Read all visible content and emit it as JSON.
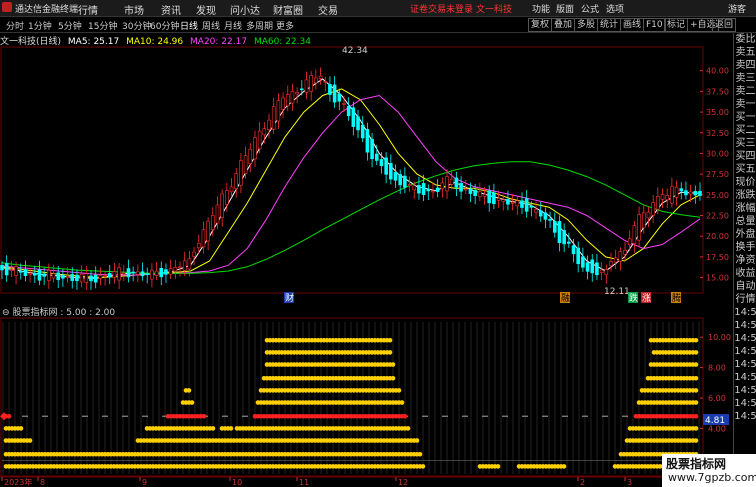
{
  "top_bar": {
    "app_title": "通达信金融终端",
    "menus": [
      "行情",
      "市场",
      "资讯",
      "发现",
      "问小达",
      "财富圈",
      "交易"
    ],
    "notice": "证卷交易未登录",
    "stock_tag": "文一科技",
    "right_menus": [
      "功能",
      "版面",
      "公式",
      "选项"
    ],
    "guest": "游客"
  },
  "toolbar": {
    "timeframes": [
      "分时",
      "1分钟",
      "5分钟",
      "15分钟",
      "30分钟",
      "60分钟",
      "日线",
      "周线",
      "月线",
      "多周期",
      "更多"
    ],
    "active": "日线",
    "right_buttons": [
      "复权",
      "叠加",
      "多股",
      "统计",
      "画线",
      "F10",
      "标记",
      "+自选",
      "返回"
    ]
  },
  "ma_line": {
    "stock": "文一科技(日线)",
    "ma5": "MA5: 25.17",
    "ma10": "MA10: 24.96",
    "ma20": "MA20: 22.17",
    "ma60": "MA60: 22.34"
  },
  "colors": {
    "ma5": "#ffffff",
    "ma10": "#ffff00",
    "ma20": "#ff40ff",
    "ma60": "#00dd00",
    "up": "#ff3030",
    "down": "#00ffff",
    "dot": "#ffd000",
    "red_dot": "#ff2020"
  },
  "price_chart": {
    "y_ticks": [
      "40.00",
      "37.50",
      "35.00",
      "32.50",
      "30.00",
      "27.50",
      "25.00",
      "22.50",
      "20.00",
      "17.50",
      "15.00"
    ],
    "high_label": "42.34",
    "low_label": "12.11",
    "markers": [
      "财",
      "融",
      "跌",
      "涨",
      "腾"
    ]
  },
  "indicator": {
    "title": "股票指标网 : 5.00 : 2.00",
    "y_ticks": [
      "10.00",
      "8.00",
      "6.00",
      "4.00",
      "2.00"
    ],
    "current": "4.81"
  },
  "x_axis": {
    "labels": [
      "2023年",
      "8",
      "9",
      "10",
      "11",
      "12",
      "2",
      "3"
    ]
  },
  "right_panel": [
    "委比",
    "卖五",
    "卖四",
    "卖三",
    "卖二",
    "卖一",
    "买一",
    "买二",
    "买三",
    "买四",
    "买五",
    "现价",
    "涨跌",
    "涨幅",
    "总量",
    "外盘",
    "换手",
    "净资",
    "收益",
    "自动",
    "行情",
    "14:5",
    "14:5",
    "14:5",
    "14:5",
    "14:5",
    "14:5",
    "14:5",
    "14:5",
    "14:5"
  ],
  "watermark": {
    "line1": "股票指标网",
    "line2": "www.7gpzb.com"
  },
  "chart_data": [
    {
      "type": "line",
      "title": "文一科技(日线)",
      "ylim": [
        13.5,
        42.5
      ],
      "series": [
        {
          "name": "MA5",
          "values": [
            16.2,
            15.8,
            15.4,
            15.2,
            15.0,
            14.9,
            15.3,
            15.6,
            15.4,
            15.7,
            16.5,
            20.0,
            24.0,
            28.0,
            32.0,
            35.5,
            37.5,
            39.0,
            37.0,
            34.0,
            30.0,
            27.5,
            26.0,
            25.5,
            26.5,
            25.5,
            24.8,
            24.2,
            23.8,
            22.5,
            20.0,
            17.0,
            15.8,
            17.5,
            21.0,
            24.0,
            25.3,
            25.2
          ]
        },
        {
          "name": "MA10",
          "values": [
            16.3,
            16.0,
            15.7,
            15.4,
            15.2,
            15.0,
            15.1,
            15.3,
            15.5,
            15.6,
            15.8,
            17.0,
            20.5,
            24.0,
            28.0,
            32.0,
            35.0,
            37.0,
            37.8,
            36.5,
            33.5,
            30.0,
            27.5,
            26.2,
            25.8,
            25.8,
            25.3,
            24.5,
            24.0,
            23.5,
            22.0,
            19.5,
            17.5,
            17.0,
            18.5,
            21.5,
            23.8,
            25.0
          ]
        },
        {
          "name": "MA20",
          "values": [
            16.4,
            16.2,
            16.0,
            15.8,
            15.6,
            15.4,
            15.3,
            15.3,
            15.4,
            15.5,
            15.6,
            15.8,
            16.5,
            18.5,
            22.0,
            26.0,
            29.5,
            32.5,
            35.0,
            36.5,
            37.0,
            35.0,
            32.0,
            29.0,
            27.0,
            26.0,
            25.5,
            25.0,
            24.5,
            24.0,
            23.5,
            22.5,
            21.0,
            19.5,
            18.5,
            19.0,
            20.5,
            22.1
          ]
        },
        {
          "name": "MA60",
          "values": [
            16.8,
            16.5,
            16.3,
            16.1,
            15.9,
            15.8,
            15.7,
            15.6,
            15.5,
            15.5,
            15.5,
            15.6,
            15.8,
            16.3,
            17.2,
            18.3,
            19.5,
            20.8,
            22.0,
            23.2,
            24.4,
            25.5,
            26.5,
            27.3,
            28.0,
            28.5,
            28.8,
            29.0,
            29.0,
            28.6,
            28.0,
            27.2,
            26.2,
            25.0,
            23.8,
            23.0,
            22.6,
            22.3
          ]
        }
      ]
    },
    {
      "type": "scatter",
      "title": "股票指标网 : 5.00 : 2.00",
      "ylim": [
        1,
        11
      ],
      "dot_rows": [
        {
          "level": 9.8,
          "ranges": [
            [
              88,
              129
            ],
            [
              216,
              231
            ]
          ],
          "color": "#ffd000"
        },
        {
          "level": 9.0,
          "ranges": [
            [
              88,
              129
            ],
            [
              217,
              231
            ]
          ],
          "color": "#ffd000"
        },
        {
          "level": 8.2,
          "ranges": [
            [
              88,
              130
            ],
            [
              216,
              231
            ]
          ],
          "color": "#ffd000"
        },
        {
          "level": 7.3,
          "ranges": [
            [
              87,
              130
            ],
            [
              215,
              231
            ]
          ],
          "color": "#ffd000"
        },
        {
          "level": 6.5,
          "ranges": [
            [
              61,
              62
            ],
            [
              86,
              132
            ],
            [
              213,
              231
            ]
          ],
          "color": "#ffd000"
        },
        {
          "level": 5.7,
          "ranges": [
            [
              60,
              63
            ],
            [
              85,
              133
            ],
            [
              212,
              231
            ]
          ],
          "color": "#ffd000"
        },
        {
          "level": 4.8,
          "ranges": [
            [
              1,
              2
            ],
            [
              55,
              67
            ],
            [
              84,
              134
            ],
            [
              211,
              231
            ]
          ],
          "color": "#ff2020"
        },
        {
          "level": 4.0,
          "ranges": [
            [
              1,
              6
            ],
            [
              48,
              70
            ],
            [
              73,
              76
            ],
            [
              78,
              135
            ],
            [
              209,
              231
            ]
          ],
          "color": "#ffd000"
        },
        {
          "level": 3.2,
          "ranges": [
            [
              1,
              9
            ],
            [
              45,
              138
            ],
            [
              208,
              231
            ]
          ],
          "color": "#ffd000"
        },
        {
          "level": 2.3,
          "ranges": [
            [
              1,
              139
            ],
            [
              206,
              231
            ]
          ],
          "color": "#ffd000"
        },
        {
          "level": 1.5,
          "ranges": [
            [
              1,
              140
            ],
            [
              159,
              165
            ],
            [
              172,
              187
            ],
            [
              204,
              231
            ]
          ],
          "color": "#ffd000"
        }
      ]
    }
  ]
}
